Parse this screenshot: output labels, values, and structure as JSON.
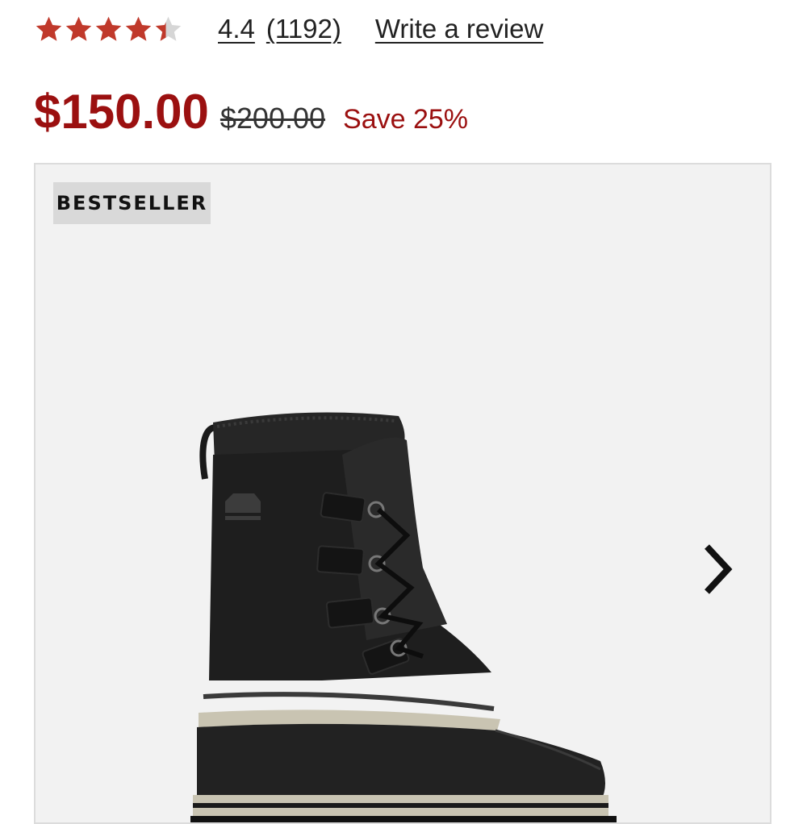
{
  "rating": {
    "stars_value": 4.4,
    "stars_max": 5,
    "star_color": "#c0392b",
    "empty_star_color": "#d6d6d6",
    "value_text": "4.4",
    "count_text": "(1192)",
    "write_review_label": "Write a review"
  },
  "price": {
    "sale": "$150.00",
    "original": "$200.00",
    "savings": "Save 25%",
    "accent_color": "#9b1010"
  },
  "gallery": {
    "badge": "BESTSELLER",
    "next_icon": "chevron-right-icon",
    "image_subject": "boot-image"
  }
}
